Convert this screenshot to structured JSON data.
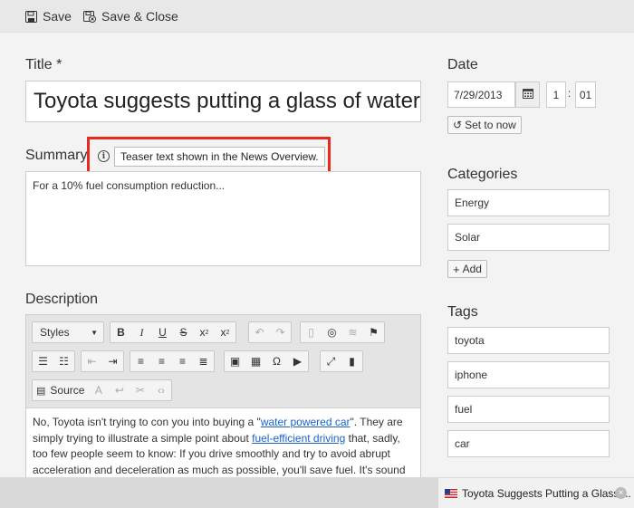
{
  "toolbar": {
    "save_label": "Save",
    "save_close_label": "Save & Close"
  },
  "title": {
    "label": "Title *",
    "value": "Toyota suggests putting a glass of water"
  },
  "summary": {
    "label": "Summary",
    "tooltip": "Teaser text shown in the News Overview.",
    "value": "For a 10% fuel consumption reduction..."
  },
  "description": {
    "label": "Description",
    "styles_label": "Styles",
    "source_label": "Source",
    "body": {
      "p1": "No, Toyota isn't trying to con you into buying a \"",
      "link1": "water powered car",
      "p2": "\". They are simply trying to illustrate a simple point about ",
      "link2": "fuel-efficient driving",
      "p3": " that, sadly, too few people seem to know: If you drive smoothly and try to avoid abrupt acceleration and deceleration as much as possible, you'll save fuel. It's sound"
    }
  },
  "date": {
    "label": "Date",
    "date_value": "7/29/2013",
    "hour": "1",
    "minute": "01",
    "set_now_label": "Set to now"
  },
  "categories": {
    "label": "Categories",
    "items": [
      "Energy",
      "Solar"
    ],
    "add_label": "Add"
  },
  "tags": {
    "label": "Tags",
    "items": [
      "toyota",
      "iphone",
      "fuel",
      "car"
    ]
  },
  "footer_tab": {
    "label": "Toyota Suggests Putting a Glass ...",
    "close": "×"
  },
  "icons": {
    "save": "floppy-disk-icon",
    "save_close": "floppy-disk-close-icon",
    "info": "info-icon",
    "calendar": "calendar-icon",
    "refresh": "refresh-icon",
    "flag": "us-flag-icon"
  },
  "colors": {
    "highlight": "#e62a1d",
    "link": "#1b62c9"
  }
}
